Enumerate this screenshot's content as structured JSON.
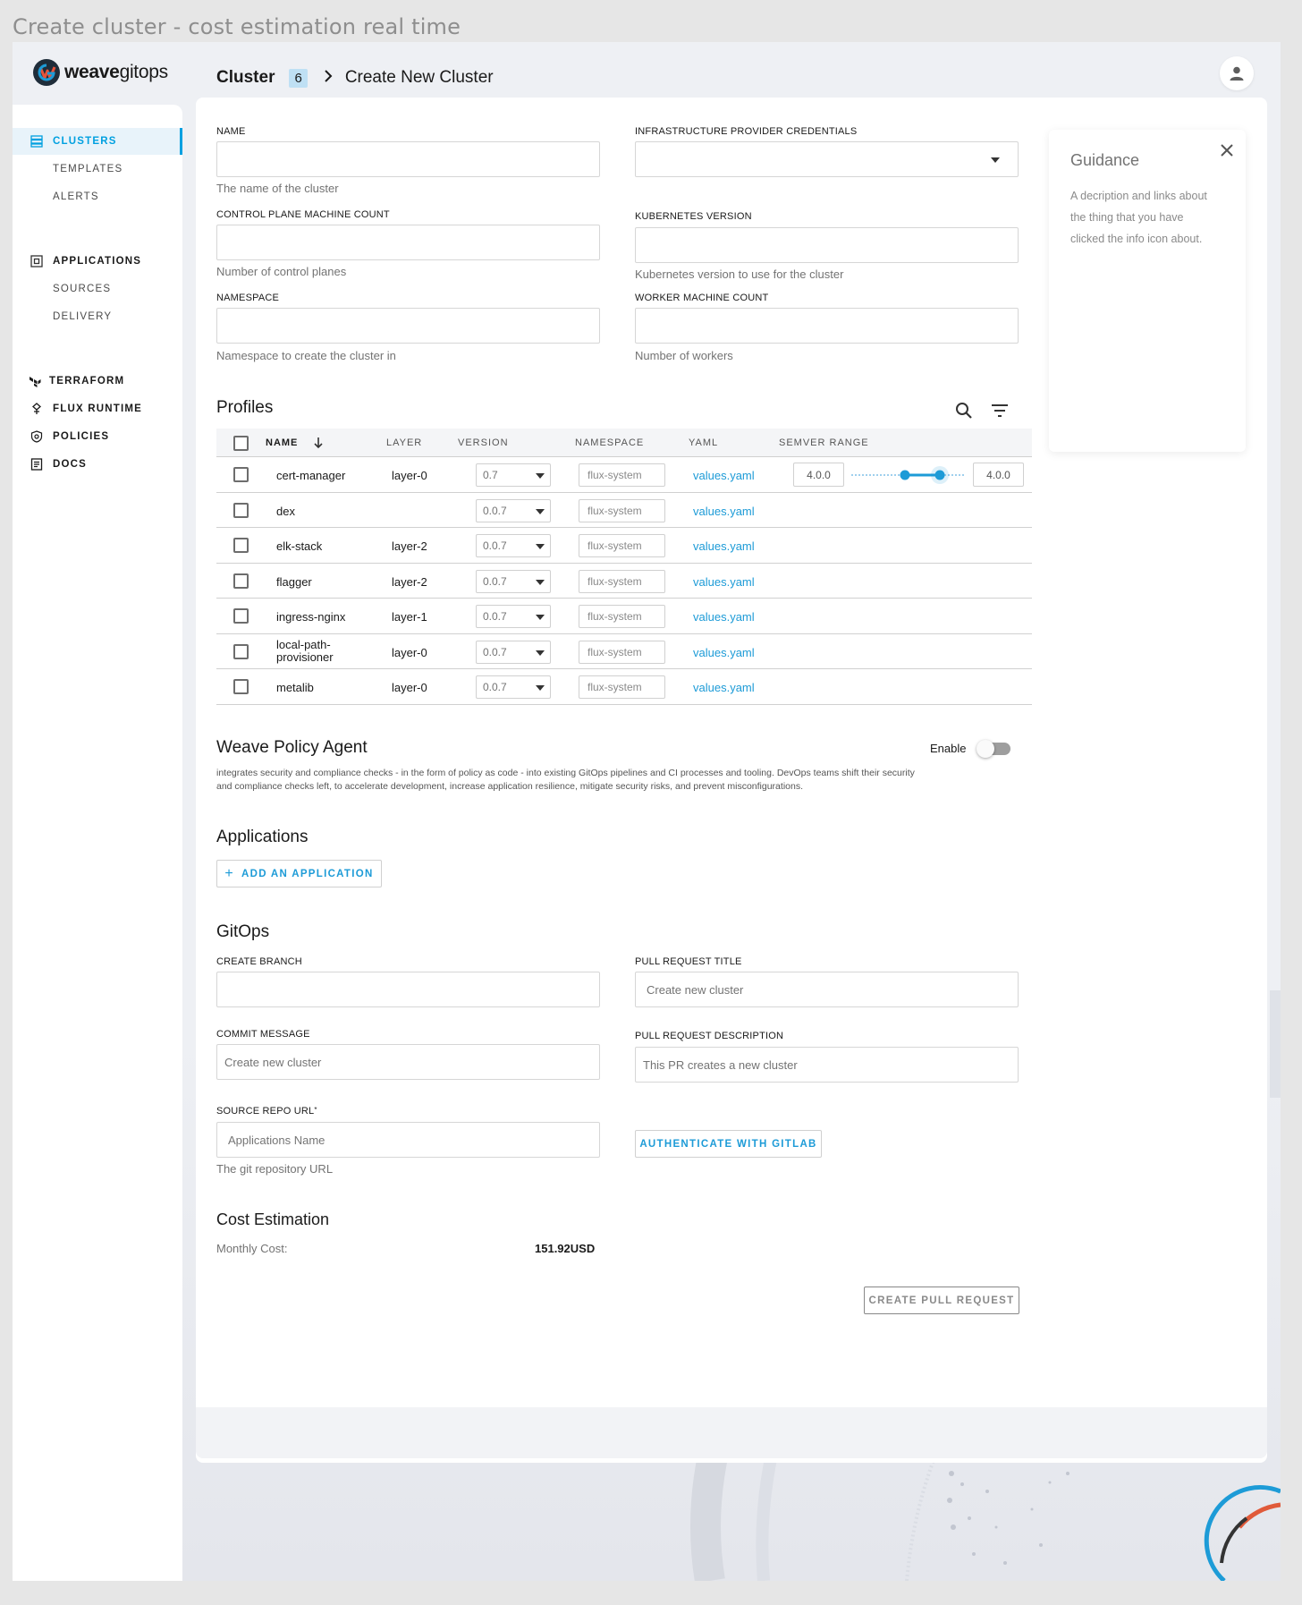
{
  "frame": {
    "title": "Create cluster - cost estimation real time"
  },
  "logo": {
    "bold": "weave",
    "light": "gitops"
  },
  "breadcrumb": {
    "root": "Cluster",
    "count": "6",
    "separator": ">",
    "page": "Create New Cluster"
  },
  "sidebar": {
    "items": [
      {
        "label": "CLUSTERS",
        "icon": "clusters-icon",
        "active": true
      },
      {
        "label": "TEMPLATES"
      },
      {
        "label": "ALERTS"
      },
      {
        "label": "APPLICATIONS",
        "icon": "applications-icon"
      },
      {
        "label": "SOURCES"
      },
      {
        "label": "DELIVERY"
      },
      {
        "label": "TERRAFORM",
        "icon": "terraform-icon"
      },
      {
        "label": "FLUX RUNTIME",
        "icon": "flux-icon"
      },
      {
        "label": "POLICIES",
        "icon": "policies-icon"
      },
      {
        "label": "DOCS",
        "icon": "docs-icon"
      }
    ]
  },
  "form": {
    "name": {
      "label": "NAME",
      "value": "",
      "help": "The name of the cluster"
    },
    "credentials": {
      "label": "INFRASTRUCTURE PROVIDER CREDENTIALS",
      "value": ""
    },
    "control_plane": {
      "label": "CONTROL PLANE MACHINE COUNT",
      "value": "",
      "help": "Number of control planes"
    },
    "k8s_version": {
      "label": "KUBERNETES VERSION",
      "value": "",
      "help": "Kubernetes version to use for the cluster"
    },
    "namespace": {
      "label": "NAMESPACE",
      "value": "",
      "help": "Namespace to create the cluster in"
    },
    "worker_count": {
      "label": "WORKER MACHINE COUNT",
      "value": "",
      "help": "Number of workers"
    }
  },
  "guidance": {
    "title": "Guidance",
    "text": "A decription and links about the thing that you have clicked the info icon about."
  },
  "profiles": {
    "title": "Profiles",
    "columns": [
      "NAME",
      "LAYER",
      "VERSION",
      "NAMESPACE",
      "YAML",
      "SEMVER RANGE"
    ],
    "rows": [
      {
        "name": "cert-manager",
        "layer": "layer-0",
        "version": "0.7",
        "namespace": "flux-system",
        "yaml": "values.yaml",
        "semver_min": "4.0.0",
        "semver_max": "4.0.0"
      },
      {
        "name": "dex",
        "layer": "",
        "version": "0.0.7",
        "namespace": "flux-system",
        "yaml": "values.yaml"
      },
      {
        "name": "elk-stack",
        "layer": "layer-2",
        "version": "0.0.7",
        "namespace": "flux-system",
        "yaml": "values.yaml"
      },
      {
        "name": "flagger",
        "layer": "layer-2",
        "version": "0.0.7",
        "namespace": "flux-system",
        "yaml": "values.yaml"
      },
      {
        "name": "ingress-nginx",
        "layer": "layer-1",
        "version": "0.0.7",
        "namespace": "flux-system",
        "yaml": "values.yaml"
      },
      {
        "name": "local-path-provisioner",
        "name_line1": "local-path-",
        "name_line2": "provisioner",
        "layer": "layer-0",
        "version": "0.0.7",
        "namespace": "flux-system",
        "yaml": "values.yaml"
      },
      {
        "name": "metalib",
        "layer": "layer-0",
        "version": "0.0.7",
        "namespace": "flux-system",
        "yaml": "values.yaml"
      }
    ]
  },
  "policy_agent": {
    "title": "Weave Policy Agent",
    "toggle_label": "Enable",
    "enabled": false,
    "description_line1": "integrates security and compliance checks - in the form of policy as code - into existing GitOps pipelines and CI processes and tooling. DevOps teams shift their security",
    "description_line2": "and compliance checks left, to accelerate development,  increase application resilience, mitigate security risks, and prevent misconfigurations."
  },
  "applications": {
    "title": "Applications",
    "add_label": "ADD AN APPLICATION"
  },
  "gitops": {
    "title": "GitOps",
    "create_branch": {
      "label": "CREATE BRANCH",
      "value": ""
    },
    "pr_title": {
      "label": "PULL REQUEST TITLE",
      "value": "Create new cluster"
    },
    "commit_message": {
      "label": "COMMIT MESSAGE",
      "value": "Create new cluster"
    },
    "pr_description": {
      "label": "PULL REQUEST DESCRIPTION",
      "value": "This PR creates a new cluster"
    },
    "source_repo": {
      "label": "SOURCE REPO URL",
      "required_mark": "*",
      "placeholder": "Applications Name",
      "help": "The git repository URL"
    },
    "auth_label": "AUTHENTICATE WITH GITLAB"
  },
  "cost": {
    "title": "Cost Estimation",
    "label": "Monthly Cost:",
    "value": "151.92USD"
  },
  "create_pr_label": "CREATE PULL REQUEST",
  "colors": {
    "accent": "#00a0e0",
    "link": "#1d9bd7",
    "badge": "#bfe0f4"
  }
}
